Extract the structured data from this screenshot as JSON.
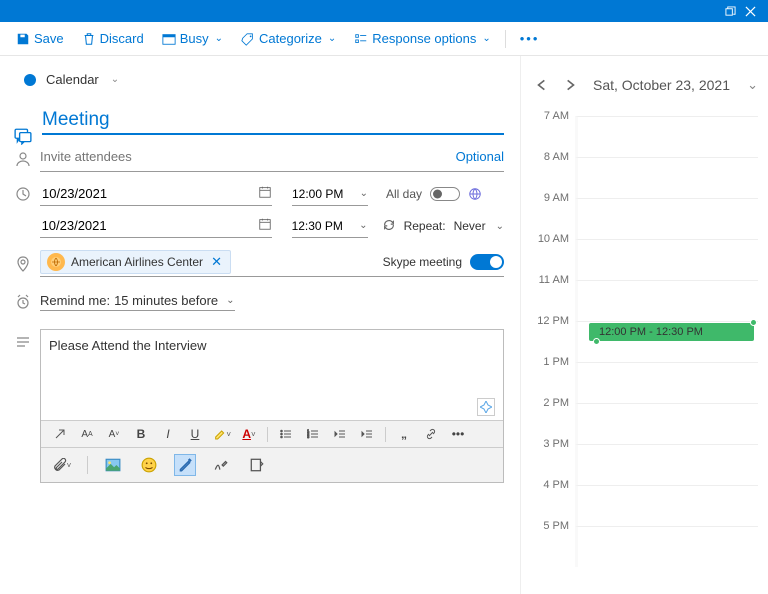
{
  "toolbar": {
    "save": "Save",
    "discard": "Discard",
    "busy": "Busy",
    "categorize": "Categorize",
    "response_options": "Response options"
  },
  "calendar_picker": {
    "label": "Calendar"
  },
  "meeting": {
    "title": "Meeting",
    "attendees_placeholder": "Invite attendees",
    "optional_label": "Optional",
    "start_date": "10/23/2021",
    "start_time": "12:00 PM",
    "end_date": "10/23/2021",
    "end_time": "12:30 PM",
    "all_day_label": "All day",
    "repeat_label": "Repeat:",
    "repeat_value": "Never",
    "location_chip": "American Airlines Center",
    "skype_label": "Skype meeting",
    "remind_label": "Remind me:",
    "remind_value": "15 minutes before",
    "body": "Please Attend the Interview"
  },
  "day_view": {
    "date_display": "Sat, October 23, 2021",
    "hours": [
      "7 AM",
      "8 AM",
      "9 AM",
      "10 AM",
      "11 AM",
      "12 PM",
      "1 PM",
      "2 PM",
      "3 PM",
      "4 PM",
      "5 PM"
    ],
    "event_label": "12:00 PM - 12:30 PM"
  }
}
